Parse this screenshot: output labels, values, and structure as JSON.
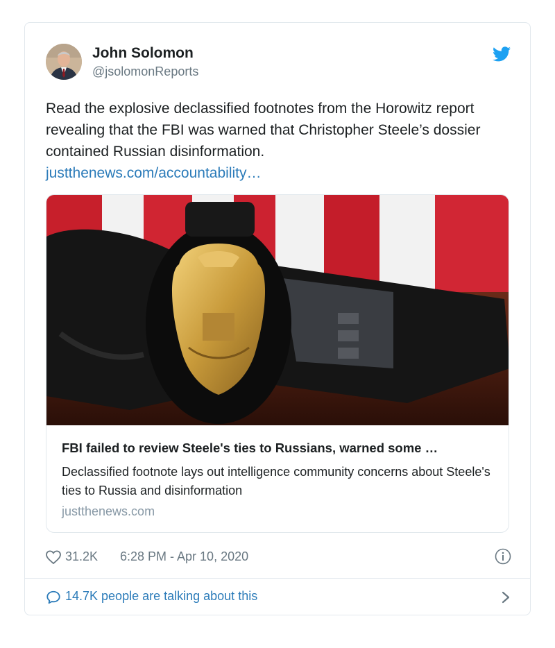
{
  "author": {
    "name": "John Solomon",
    "handle": "@jsolomonReports"
  },
  "tweet": {
    "text": "Read the explosive declassified footnotes from the Horowitz report revealing that the FBI was warned that Christopher Steele’s dossier contained Russian disinformation.",
    "link": "justthenews.com/accountability…"
  },
  "link_card": {
    "title": "FBI failed to review Steele's ties to Russians, warned some …",
    "description": "Declassified footnote lays out intelligence community concerns about Steele's ties to Russia and disinformation",
    "domain": "justthenews.com",
    "image": "fbi-badge-holster-flag-photo"
  },
  "meta": {
    "likes": "31.2K",
    "timestamp": "6:28 PM - Apr 10, 2020"
  },
  "conversation": {
    "text": "14.7K people are talking about this"
  },
  "icons": {
    "brand": "twitter-bird-icon",
    "like": "heart-icon",
    "info": "info-icon",
    "reply": "speech-bubble-icon",
    "chevron": "chevron-right-icon"
  },
  "colors": {
    "link": "#2b7bb9",
    "brand": "#1da1f2",
    "muted": "#697882",
    "border": "#e1e8ed"
  }
}
